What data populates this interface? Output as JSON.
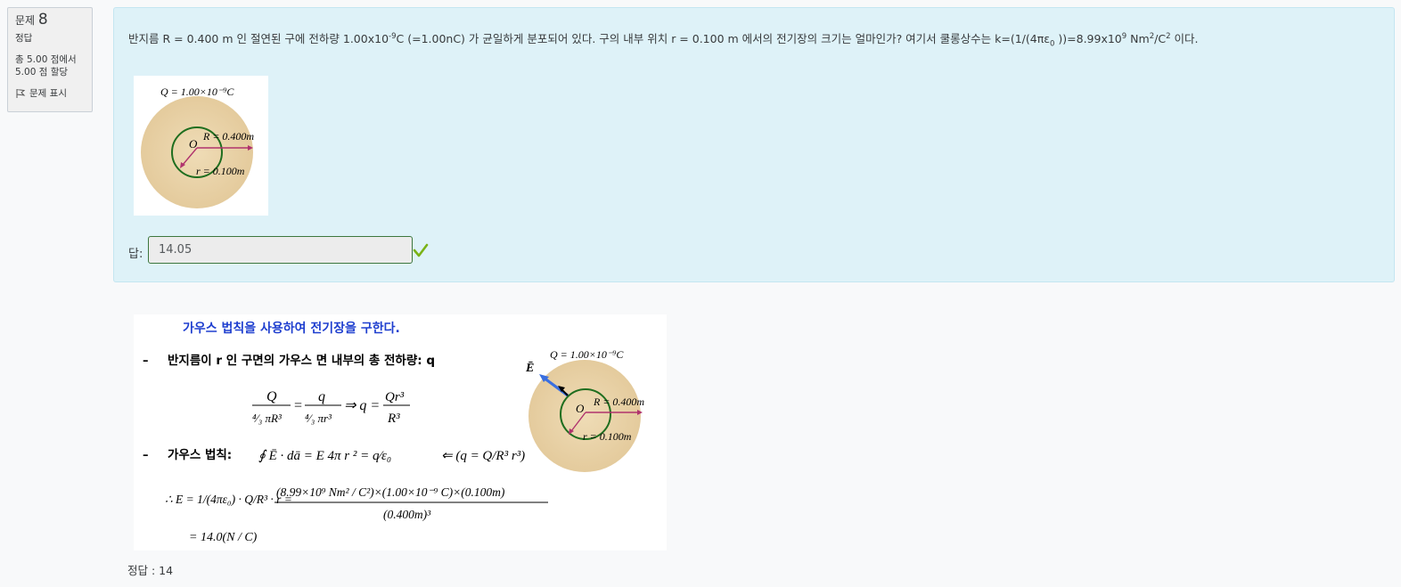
{
  "info": {
    "question_prefix": "문제",
    "question_number": "8",
    "state": "정답",
    "grade_line1": "총 5.00 점에서",
    "grade_line2": "5.00 점 할당",
    "flag_label": "문제 표시"
  },
  "question": {
    "text_part1": "반지름 R = 0.400 m  인 절연된 구에 전하량 1.00x10",
    "exp1": "-9",
    "text_part2": "C (=1.00nC) 가 균일하게 분포되어 있다. 구의 내부 위치 r = 0.100 m  에서의 전기장의 크기는 얼마인가?  여기서 쿨롱상수는 k=(1/(4πε",
    "sub0": "0",
    "text_part3": " ))=8.99x10",
    "exp9": "9",
    "text_part4": " Nm",
    "exp2a": "2",
    "text_part5": "/C",
    "exp2b": "2",
    "text_part6": " 이다."
  },
  "figure1": {
    "charge_label": "Q = 1.00×10⁻⁹C",
    "center_label": "O",
    "R_label": "R = 0.400m",
    "r_label": "r = 0.100m"
  },
  "answer": {
    "label": "답:",
    "value": "14.05",
    "status_icon": "check-icon",
    "correct_color": "#7ab317"
  },
  "feedback": {
    "heading": "가우스 법칙을 사용하여 전기장을 구한다.",
    "bullet1": "반지름이 r 인 구면의 가우스 면 내부의 총 전하량: q",
    "bullet2": "가우스 법칙:",
    "eq1_Q": "Q",
    "eq1_q": "q",
    "eq1_den1": "⁴⁄₃ πR³",
    "eq1_den2": "⁴⁄₃ πr³",
    "eq1_impl": "⇒ q =",
    "eq1_rhs_num": "Qr³",
    "eq1_rhs_den": "R³",
    "gauss_eq": "∮ Ē · dā  =  E 4π r ²  =  q⁄ε₀",
    "gauss_hint": "⇐ (q = Q/R³ r³)",
    "result_lhs": "∴ E = 1/(4πε₀) · Q/R³ · r =",
    "result_num": "(8.99×10⁹ Nm² / C²)×(1.00×10⁻⁹ C)×(0.100m)",
    "result_den": "(0.400m)³",
    "result_final": "= 14.0(N / C)",
    "E_label": "Ē",
    "charge_label": "Q = 1.00×10⁻⁹C",
    "center_label": "O",
    "R_label": "R = 0.400m",
    "r_label": "r = 0.100m"
  },
  "right_answer": "정답 : 14"
}
